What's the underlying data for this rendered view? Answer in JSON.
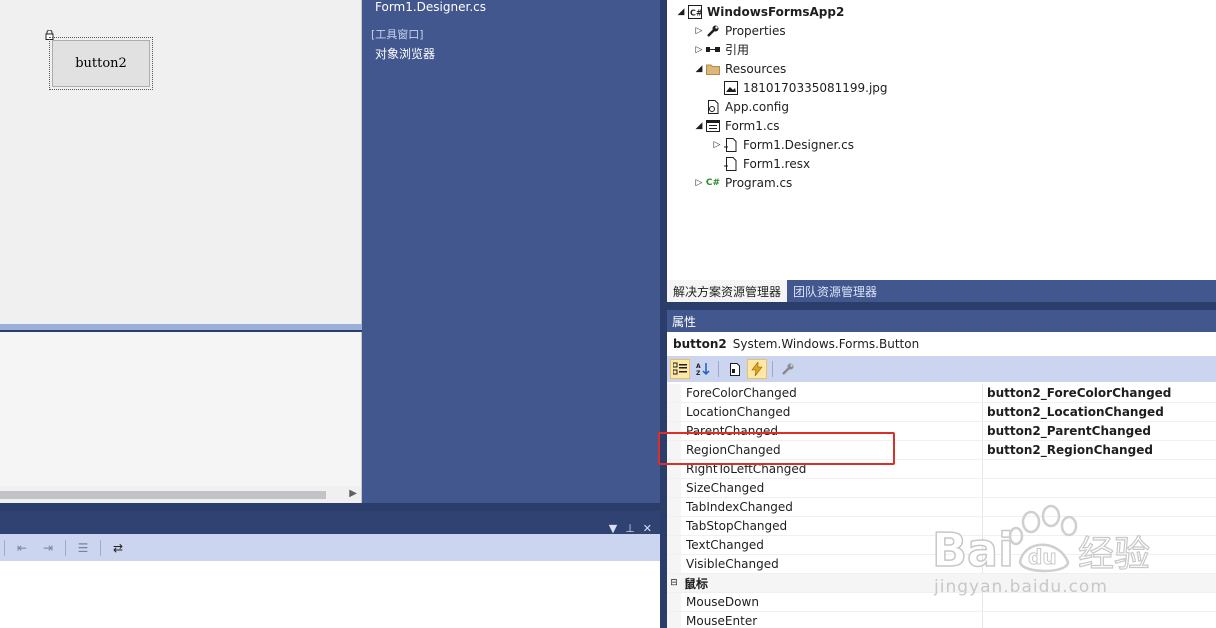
{
  "designer": {
    "button_label": "button2"
  },
  "middle_panel": {
    "file_label": "Form1.Designer.cs",
    "category": "[工具窗口]",
    "item": "对象浏览器"
  },
  "solution_explorer": {
    "tree": [
      {
        "label": "WindowsFormsApp2",
        "icon": "csharp-project-icon",
        "arrow": "expanded",
        "bold": true
      },
      {
        "label": "Properties",
        "icon": "wrench-icon",
        "arrow": "collapsed"
      },
      {
        "label": "引用",
        "icon": "references-icon",
        "arrow": "collapsed"
      },
      {
        "label": "Resources",
        "icon": "folder-icon",
        "arrow": "expanded"
      },
      {
        "label": "1810170335081199.jpg",
        "icon": "image-file-icon",
        "arrow": "none"
      },
      {
        "label": "App.config",
        "icon": "config-file-icon",
        "arrow": "none"
      },
      {
        "label": "Form1.cs",
        "icon": "form-icon",
        "arrow": "expanded"
      },
      {
        "label": "Form1.Designer.cs",
        "icon": "cs-file-icon",
        "arrow": "collapsed"
      },
      {
        "label": "Form1.resx",
        "icon": "resx-file-icon",
        "arrow": "none"
      },
      {
        "label": "Program.cs",
        "icon": "csharp-file-icon",
        "arrow": "collapsed"
      }
    ],
    "tabs": [
      "解决方案资源管理器",
      "团队资源管理器"
    ]
  },
  "properties": {
    "title": "属性",
    "object_name": "button2",
    "object_type": "System.Windows.Forms.Button",
    "rows": [
      {
        "name": "ForeColorChanged",
        "value": "button2_ForeColorChanged"
      },
      {
        "name": "LocationChanged",
        "value": "button2_LocationChanged"
      },
      {
        "name": "ParentChanged",
        "value": "button2_ParentChanged"
      },
      {
        "name": "RegionChanged",
        "value": "button2_RegionChanged"
      },
      {
        "name": "RightToLeftChanged",
        "value": ""
      },
      {
        "name": "SizeChanged",
        "value": ""
      },
      {
        "name": "TabIndexChanged",
        "value": ""
      },
      {
        "name": "TabStopChanged",
        "value": ""
      },
      {
        "name": "TextChanged",
        "value": ""
      },
      {
        "name": "VisibleChanged",
        "value": ""
      }
    ],
    "category_label": "鼠标",
    "rows_after": [
      {
        "name": "MouseDown",
        "value": ""
      },
      {
        "name": "MouseEnter",
        "value": ""
      }
    ]
  },
  "watermark": {
    "url": "jingyan.baidu.com"
  },
  "colors": {
    "accent_panel": "#42578e",
    "highlight": "#d9302a"
  }
}
